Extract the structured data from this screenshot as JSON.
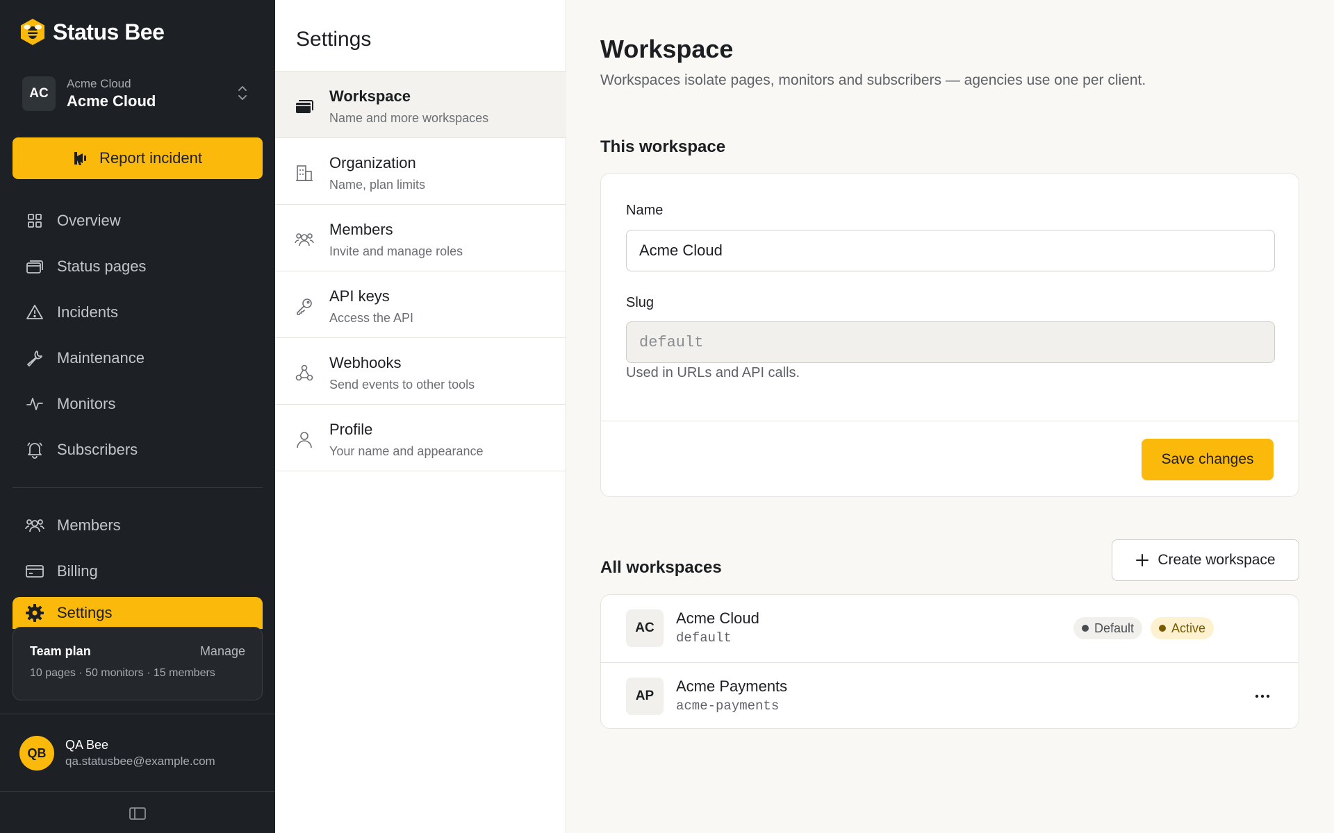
{
  "brand": {
    "name": "Status Bee"
  },
  "workspace_switcher": {
    "avatar": "AC",
    "org": "Acme Cloud",
    "name": "Acme Cloud"
  },
  "report_button": {
    "label": "Report incident"
  },
  "nav": {
    "items": [
      {
        "label": "Overview",
        "icon": "grid-icon"
      },
      {
        "label": "Status pages",
        "icon": "pages-icon"
      },
      {
        "label": "Incidents",
        "icon": "warning-icon"
      },
      {
        "label": "Maintenance",
        "icon": "wrench-icon"
      },
      {
        "label": "Monitors",
        "icon": "pulse-icon"
      },
      {
        "label": "Subscribers",
        "icon": "bell-icon"
      }
    ],
    "secondary": [
      {
        "label": "Members",
        "icon": "users-icon"
      },
      {
        "label": "Billing",
        "icon": "card-icon"
      },
      {
        "label": "Settings",
        "icon": "gear-icon"
      }
    ]
  },
  "plan": {
    "name": "Team plan",
    "manage": "Manage",
    "limits": "10 pages · 50 monitors · 15 members"
  },
  "user": {
    "initials": "QB",
    "name": "QA Bee",
    "email": "qa.statusbee@example.com"
  },
  "settings_menu": {
    "title": "Settings",
    "items": [
      {
        "label": "Workspace",
        "desc": "Name and more workspaces",
        "icon": "folder-icon"
      },
      {
        "label": "Organization",
        "desc": "Name, plan limits",
        "icon": "building-icon"
      },
      {
        "label": "Members",
        "desc": "Invite and manage roles",
        "icon": "users-icon"
      },
      {
        "label": "API keys",
        "desc": "Access the API",
        "icon": "key-icon"
      },
      {
        "label": "Webhooks",
        "desc": "Send events to other tools",
        "icon": "webhook-icon"
      },
      {
        "label": "Profile",
        "desc": "Your name and appearance",
        "icon": "user-icon"
      }
    ]
  },
  "main": {
    "title": "Workspace",
    "description": "Workspaces isolate pages, monitors and subscribers — agencies use one per client.",
    "this_workspace": {
      "heading": "This workspace",
      "name_label": "Name",
      "name_value": "Acme Cloud",
      "slug_label": "Slug",
      "slug_value": "default",
      "slug_help": "Used in URLs and API calls.",
      "save_label": "Save changes"
    },
    "all_workspaces": {
      "heading": "All workspaces",
      "create_label": "Create workspace",
      "rows": [
        {
          "avatar": "AC",
          "name": "Acme Cloud",
          "slug": "default",
          "badges": [
            "Default",
            "Active"
          ]
        },
        {
          "avatar": "AP",
          "name": "Acme Payments",
          "slug": "acme-payments",
          "more": "···"
        }
      ]
    }
  },
  "colors": {
    "accent": "#fbb90b",
    "sidebar": "#1d2125",
    "background": "#f9f8f5"
  }
}
